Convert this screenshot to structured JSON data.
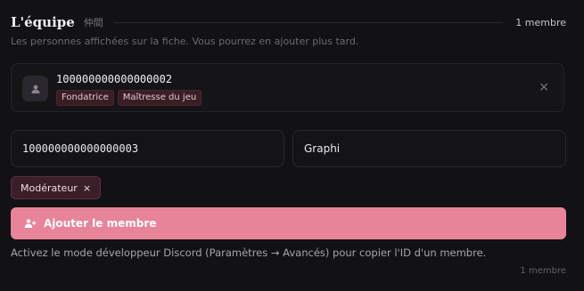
{
  "header": {
    "title": "L'équipe",
    "title_jp": "仲間",
    "count": "1 membre"
  },
  "subtitle": "Les personnes affichées sur la fiche. Vous pourrez en ajouter plus tard.",
  "member": {
    "id": "100000000000000002",
    "avatar_icon": "user-icon",
    "roles": [
      "Fondatrice",
      "Maîtresse du jeu"
    ],
    "remove_icon": "close-icon"
  },
  "form": {
    "id_value": "100000000000000003",
    "name_value": "Graphi",
    "selected_role": "Modérateur"
  },
  "add_button": {
    "label": "Ajouter le membre",
    "icon": "user-plus-icon",
    "color": "#e8849a"
  },
  "hint": "Activez le mode développeur Discord (Paramètres → Avancés) pour copier l'ID d'un membre.",
  "footer_count": "1 membre"
}
